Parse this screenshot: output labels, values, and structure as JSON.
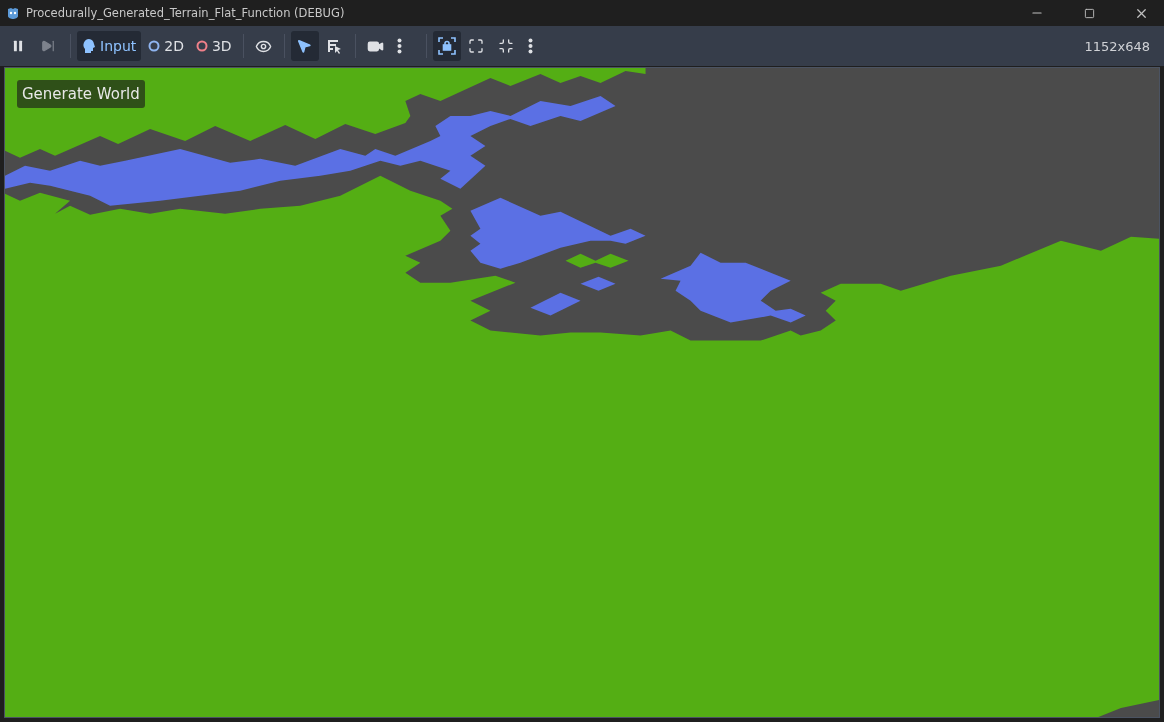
{
  "window": {
    "title": "Procedurally_Generated_Terrain_Flat_Function (DEBUG)"
  },
  "toolbar": {
    "groups": [
      [
        {
          "kind": "pause",
          "selected": false,
          "disabled": false
        },
        {
          "kind": "step",
          "selected": false,
          "disabled": true
        }
      ],
      [
        {
          "kind": "input",
          "label": "Input",
          "selected": true,
          "disabled": false
        },
        {
          "kind": "ring",
          "label": "2D",
          "color": "#8fb4f0",
          "selected": false,
          "disabled": false
        },
        {
          "kind": "ring",
          "label": "3D",
          "color": "#f0808a",
          "selected": false,
          "disabled": false
        }
      ],
      [
        {
          "kind": "eye",
          "selected": false,
          "disabled": false
        }
      ],
      [
        {
          "kind": "pointer",
          "selected": true,
          "disabled": false
        },
        {
          "kind": "list-pointer",
          "selected": false,
          "disabled": false
        }
      ],
      [
        {
          "kind": "camera",
          "selected": false,
          "disabled": false
        },
        {
          "kind": "more",
          "selected": false,
          "disabled": false
        }
      ],
      [
        {
          "kind": "lock",
          "selected": true,
          "disabled": false
        },
        {
          "kind": "expand",
          "selected": false,
          "disabled": false
        },
        {
          "kind": "shrink",
          "selected": false,
          "disabled": false
        },
        {
          "kind": "more",
          "selected": false,
          "disabled": false
        }
      ]
    ],
    "resolution": "1152x648"
  },
  "game": {
    "button": "Generate World"
  }
}
